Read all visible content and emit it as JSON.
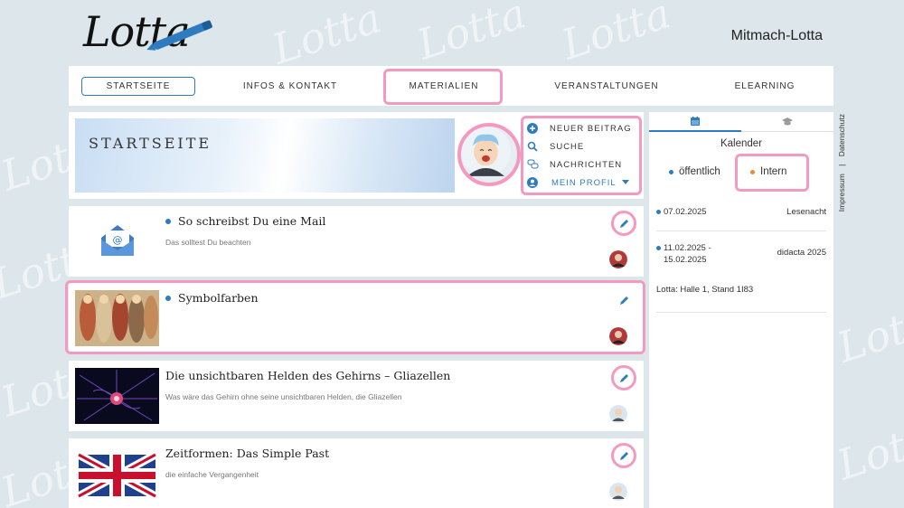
{
  "header": {
    "logo_text": "Lotta",
    "site_name": "Mitmach-Lotta"
  },
  "nav": {
    "items": [
      {
        "label": "STARTSEITE"
      },
      {
        "label": "INFOS & KONTAKT"
      },
      {
        "label": "MATERIALIEN"
      },
      {
        "label": "VERANSTALTUNGEN"
      },
      {
        "label": "ELEARNING"
      }
    ]
  },
  "hero": {
    "title": "STARTSEITE"
  },
  "profile_menu": {
    "new_post": "NEUER BEITRAG",
    "search": "SUCHE",
    "messages": "NACHRICHTEN",
    "my_profile": "MEIN PROFIL"
  },
  "posts": [
    {
      "title": "So schreibst Du eine Mail",
      "subtitle": "Das solltest Du beachten",
      "dot": true
    },
    {
      "title": "Symbolfarben",
      "subtitle": "",
      "dot": true
    },
    {
      "title": "Die unsichtbaren Helden des Gehirns – Gliazellen",
      "subtitle": "Was wäre das Gehirn ohne seine unsichtbaren Helden, die Gliazellen",
      "dot": false
    },
    {
      "title": "Zeitformen: Das Simple Past",
      "subtitle": "die einfache Vergangenheit",
      "dot": false
    }
  ],
  "sidebar": {
    "calendar_title": "Kalender",
    "legend_public": "öffentlich",
    "legend_internal": "Intern",
    "events": [
      {
        "date": "07.02.2025",
        "name": "Lesenacht"
      },
      {
        "date": "11.02.2025 - 15.02.2025",
        "name": "didacta 2025"
      }
    ],
    "event_detail": "Lotta: Halle 1, Stand 1I83"
  },
  "footer_links": {
    "imprint": "Impressum",
    "separator": "|",
    "privacy": "Datenschutz"
  },
  "colors": {
    "accent": "#2e7bbf",
    "highlight": "#f49ac1",
    "internal": "#e8883a",
    "background": "#dde6ea"
  },
  "icons": [
    "pen-icon",
    "plus-circle-icon",
    "search-icon",
    "chat-icon",
    "user-circle-icon",
    "caret-down-icon",
    "calendar-icon",
    "graduation-cap-icon",
    "pencil-icon"
  ]
}
